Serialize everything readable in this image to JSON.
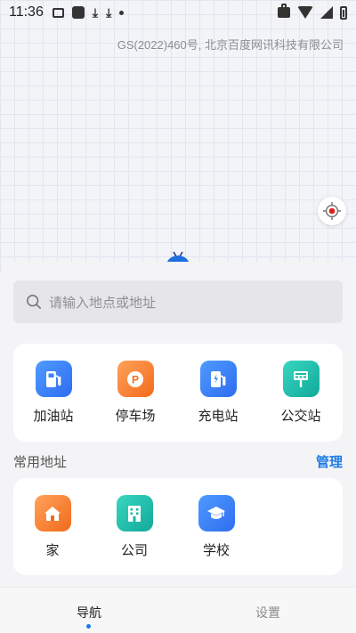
{
  "status_bar": {
    "time": "11:36"
  },
  "map": {
    "copyright": "GS(2022)460号, 北京百度网讯科技有限公司"
  },
  "search": {
    "placeholder": "请输入地点或地址"
  },
  "poi_categories": [
    {
      "label": "加油站",
      "icon": "gas-station-icon",
      "color": "#3b82f6"
    },
    {
      "label": "停车场",
      "icon": "parking-icon",
      "color": "#f97316"
    },
    {
      "label": "充电站",
      "icon": "charging-station-icon",
      "color": "#3b82f6"
    },
    {
      "label": "公交站",
      "icon": "bus-stop-icon",
      "color": "#14b8a6"
    }
  ],
  "common_addresses": {
    "title": "常用地址",
    "manage_label": "管理",
    "items": [
      {
        "label": "家",
        "icon": "home-icon",
        "color": "#f97316"
      },
      {
        "label": "公司",
        "icon": "office-building-icon",
        "color": "#14b8a6"
      },
      {
        "label": "学校",
        "icon": "graduation-cap-icon",
        "color": "#3b82f6"
      }
    ]
  },
  "tabs": {
    "navigation": "导航",
    "settings": "设置"
  },
  "colors": {
    "accent": "#1f7ae8",
    "location_red": "#e02020"
  }
}
